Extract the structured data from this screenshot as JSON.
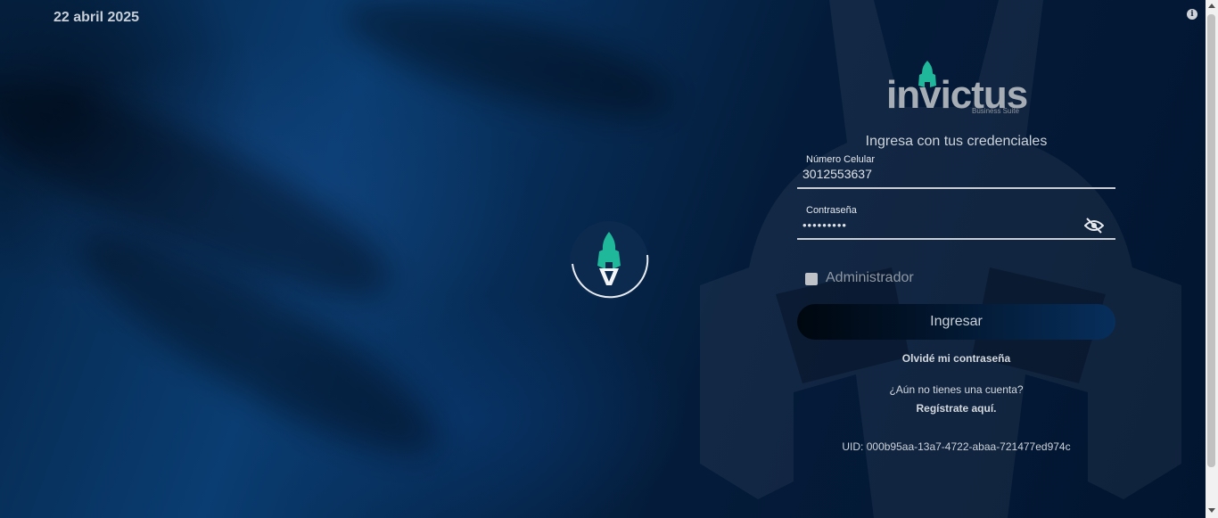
{
  "header": {
    "date": "22 abril 2025"
  },
  "brand": {
    "name": "invictus",
    "tagline": "Business Suite"
  },
  "login": {
    "subtitle": "Ingresa con tus credenciales",
    "phone_label": "Número Celular",
    "phone_value": "3012553637",
    "password_label": "Contraseña",
    "password_value": "•••••••••",
    "admin_label": "Administrador",
    "submit_label": "Ingresar",
    "forgot_label": "Olvidé mi contraseña",
    "no_account_label": "¿Aún no tienes una cuenta?",
    "register_label": "Regístrate aquí.",
    "uid": "UID: 000b95aa-13a7-4722-abaa-721477ed974c"
  },
  "icons": {
    "info": "info-icon",
    "eye": "eye-off-icon",
    "logo": "spartan-helmet-icon"
  },
  "colors": {
    "accent": "#1fb89a",
    "background": "#03152d",
    "button_end": "#072f5c"
  }
}
